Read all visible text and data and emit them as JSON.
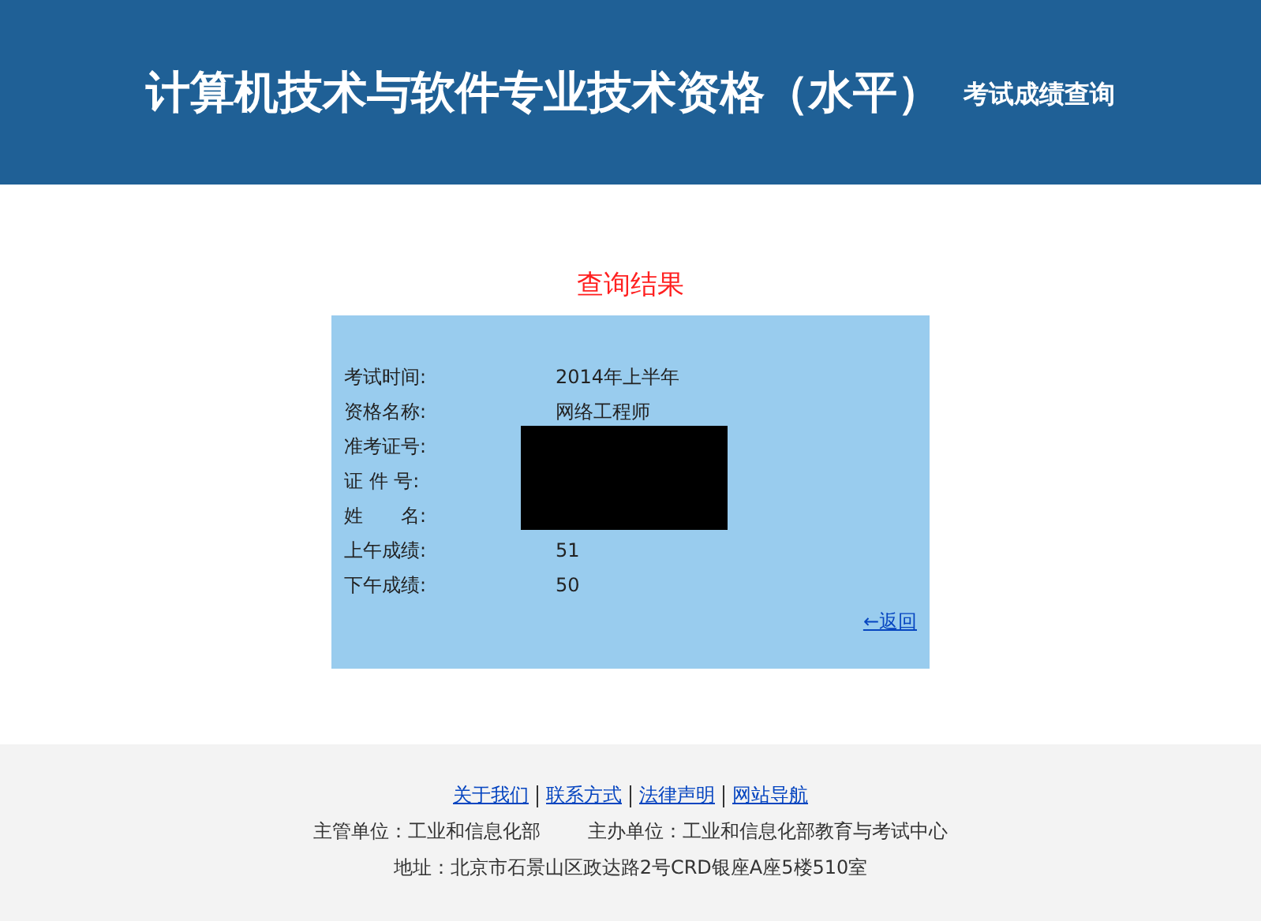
{
  "header": {
    "title": "计算机技术与软件专业技术资格（水平）",
    "subtitle": "考试成绩查询"
  },
  "result": {
    "title": "查询结果",
    "rows": [
      {
        "label": "考试时间:",
        "value": "2014年上半年"
      },
      {
        "label": "资格名称:",
        "value": "网络工程师"
      },
      {
        "label": "准考证号:"
      },
      {
        "label": "证 件 号:"
      },
      {
        "label": "姓　　名:"
      },
      {
        "label": "上午成绩:",
        "value": "51"
      },
      {
        "label": "下午成绩:",
        "value": "50"
      }
    ],
    "back_link": "←返回"
  },
  "footer": {
    "links": [
      "关于我们",
      "联系方式",
      "法律声明",
      "网站导航"
    ],
    "organizers": [
      "主管单位：工业和信息化部",
      "主办单位：工业和信息化部教育与考试中心"
    ],
    "address": "地址：北京市石景山区政达路2号CRD银座A座5楼510室"
  }
}
